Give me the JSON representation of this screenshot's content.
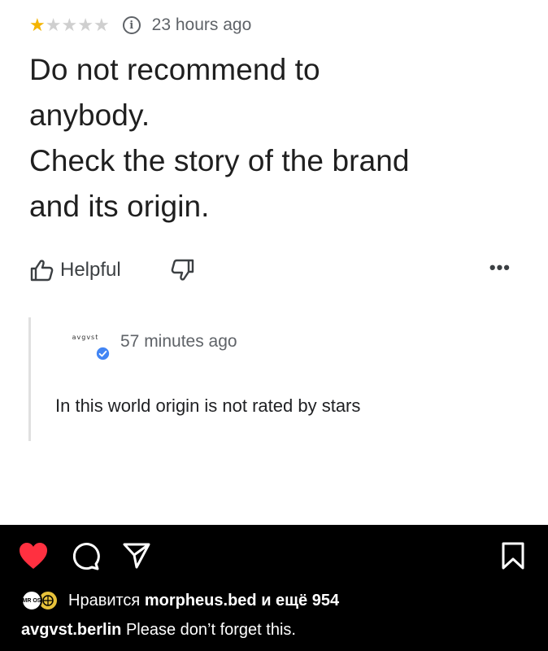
{
  "review": {
    "rating": 1,
    "rating_max": 5,
    "time": "23 hours ago",
    "text_lines": [
      "Do not recommend to",
      "anybody.",
      "Check the story of the brand",
      "and its origin."
    ],
    "helpful_label": "Helpful",
    "more_label": "•••"
  },
  "reply": {
    "owner_logo": "avgvst",
    "time": "57 minutes ago",
    "text": "In this world origin is not rated by stars"
  },
  "instagram": {
    "likes_prefix": "Нравится",
    "likes_user": "morpheus.bed",
    "likes_suffix": "и ещё 954",
    "caption_user": "avgvst.berlin",
    "caption_text": "Please don’t forget this.",
    "avatar1_text": "MR OS",
    "colors": {
      "heart": "#ff3040",
      "star": "#f4b400",
      "verified": "#4285f4"
    }
  }
}
